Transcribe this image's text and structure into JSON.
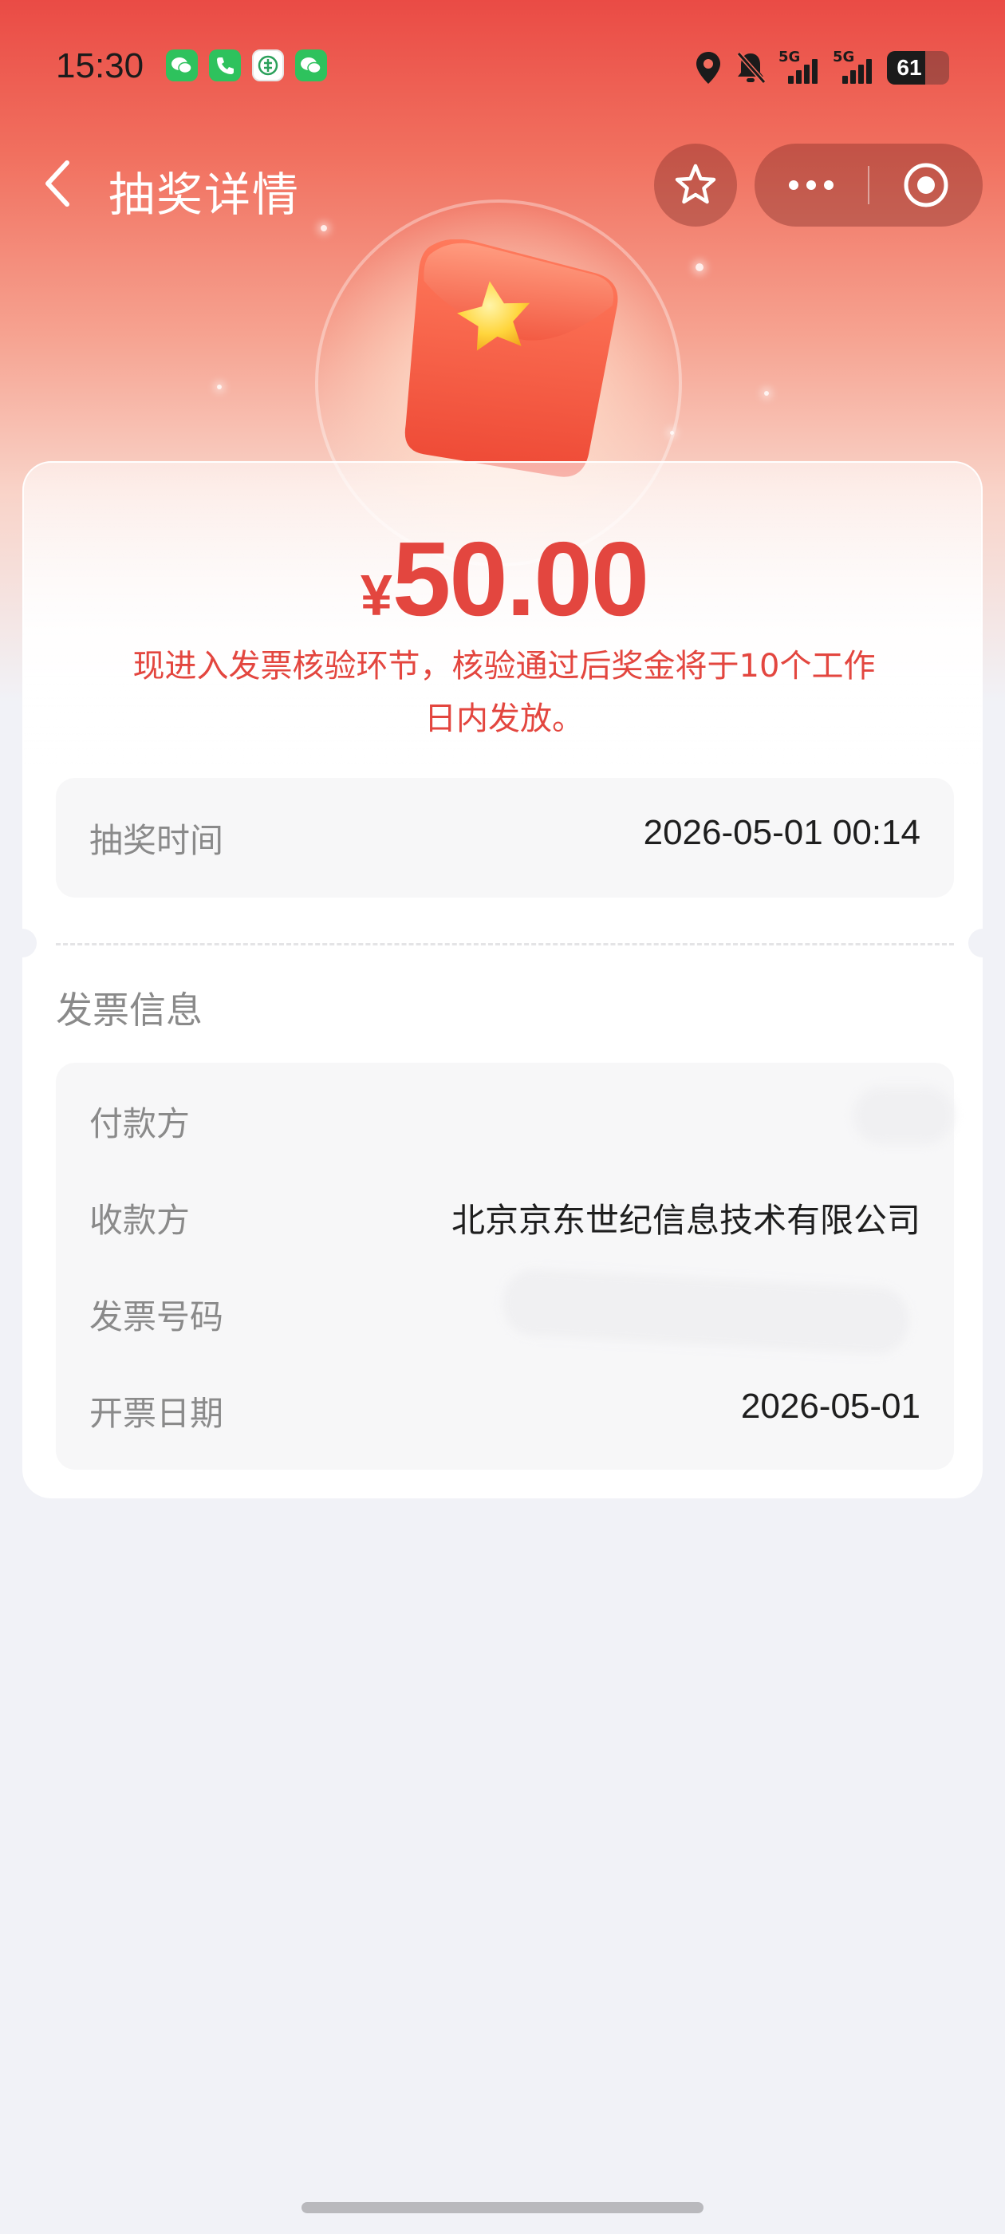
{
  "status_bar": {
    "time": "15:30",
    "app_icons": [
      "wechat-icon",
      "phone-icon",
      "bank-icon",
      "wechat-icon"
    ],
    "signal_1": "5G",
    "signal_2": "5G",
    "battery": "61"
  },
  "nav": {
    "back_icon": "chevron-left-icon",
    "title": "抽奖详情"
  },
  "capsule": {
    "more_icon": "more-dots-icon",
    "close_icon": "target-circle-icon"
  },
  "prize": {
    "currency": "¥",
    "amount": "50.00",
    "notice": "现进入发票核验环节，核验通过后奖金将于10个工作日内发放。"
  },
  "draw": {
    "label": "抽奖时间",
    "value": "2026-05-01 00:14"
  },
  "invoice": {
    "section_title": "发票信息",
    "rows": [
      {
        "label": "付款方",
        "value": ""
      },
      {
        "label": "收款方",
        "value": "北京京东世纪信息技术有限公司"
      },
      {
        "label": "发票号码",
        "value": ""
      },
      {
        "label": "开票日期",
        "value": "2026-05-01"
      }
    ]
  },
  "colors": {
    "accent": "#e3463f",
    "background": "#f1f2f7"
  }
}
